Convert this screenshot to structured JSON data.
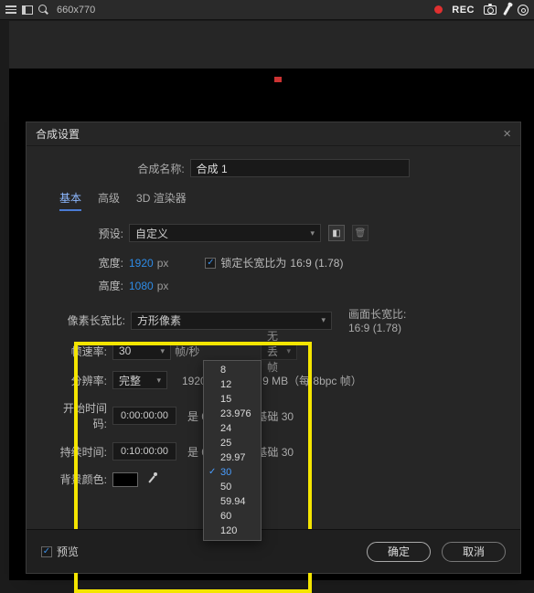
{
  "topbar": {
    "search_text": "660x770",
    "rec_label": "REC"
  },
  "dialog": {
    "title": "合成设置",
    "comp_name_label": "合成名称:",
    "comp_name_value": "合成 1",
    "tabs": {
      "basic": "基本",
      "advanced": "高级",
      "renderer": "3D 渲染器"
    },
    "preset": {
      "label": "预设:",
      "value": "自定义"
    },
    "width": {
      "label": "宽度:",
      "value": "1920",
      "unit": "px"
    },
    "height": {
      "label": "高度:",
      "value": "1080",
      "unit": "px"
    },
    "lock_aspect": {
      "label": "锁定长宽比为",
      "ratio": "16:9 (1.78)",
      "checked": true
    },
    "par": {
      "label": "像素长宽比:",
      "value": "方形像素"
    },
    "frame_aspect": {
      "label": "画面长宽比:",
      "value": "16:9 (1.78)"
    },
    "fps": {
      "label": "帧速率:",
      "value": "30",
      "unit_label": "帧/秒",
      "drop_label": "无丢帧"
    },
    "resolution": {
      "label": "分辨率:",
      "value": "完整",
      "info": "1920 x 1080，7.9 MB（每 8bpc 帧）"
    },
    "start": {
      "label": "开始时间码:",
      "value": "0:00:00:00",
      "basis": "是 0:00:00:00 基础 30"
    },
    "duration": {
      "label": "持续时间:",
      "value": "0:10:00:00",
      "basis": "是 0:10:00:00 基础 30"
    },
    "bgcolor": {
      "label": "背景颜色:",
      "swatch": "#000000"
    },
    "fps_options": [
      "8",
      "12",
      "15",
      "23.976",
      "24",
      "25",
      "29.97",
      "30",
      "50",
      "59.94",
      "60",
      "120"
    ],
    "fps_selected": "30",
    "footer": {
      "preview": "预览",
      "ok": "确定",
      "cancel": "取消"
    }
  }
}
